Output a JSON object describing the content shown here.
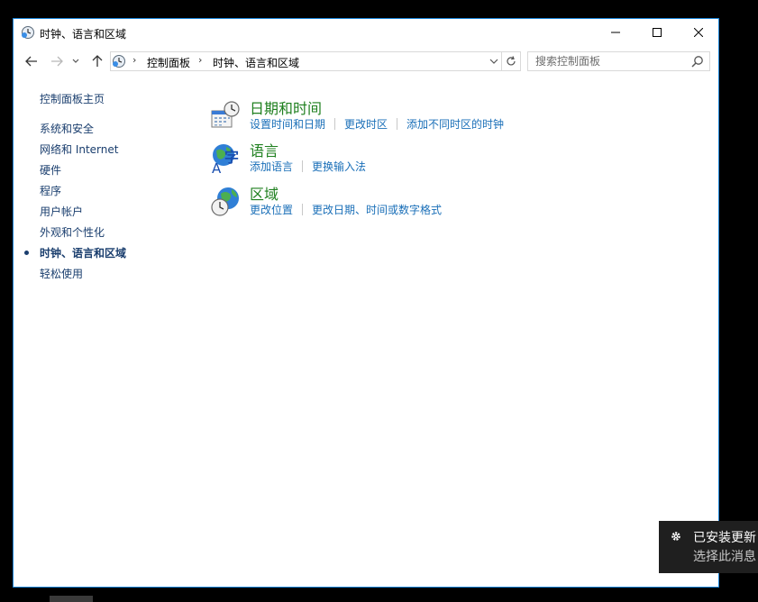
{
  "window": {
    "title": "时钟、语言和区域",
    "icon": "clock-globe-icon"
  },
  "address_bar": {
    "crumbs": [
      "控制面板",
      "时钟、语言和区域"
    ]
  },
  "search": {
    "placeholder": "搜索控制面板"
  },
  "sidebar": {
    "items": [
      {
        "label": "控制面板主页"
      },
      {
        "label": "系统和安全"
      },
      {
        "label": "网络和 Internet"
      },
      {
        "label": "硬件"
      },
      {
        "label": "程序"
      },
      {
        "label": "用户帐户"
      },
      {
        "label": "外观和个性化"
      },
      {
        "label": "时钟、语言和区域",
        "active": true
      },
      {
        "label": "轻松使用"
      }
    ]
  },
  "categories": [
    {
      "title": "日期和时间",
      "icon": "calendar-clock-icon",
      "links": [
        "设置时间和日期",
        "更改时区",
        "添加不同时区的时钟"
      ]
    },
    {
      "title": "语言",
      "icon": "language-globe-icon",
      "links": [
        "添加语言",
        "更换输入法"
      ]
    },
    {
      "title": "区域",
      "icon": "region-globe-clock-icon",
      "links": [
        "更改位置",
        "更改日期、时间或数字格式"
      ]
    }
  ],
  "toast": {
    "line1": "已安装更新",
    "line2": "选择此消息"
  },
  "colors": {
    "window_border": "#1883d7",
    "category_title": "#1e7f1e",
    "link": "#1a6fb8",
    "sidebar_link": "#1a3e6e"
  }
}
